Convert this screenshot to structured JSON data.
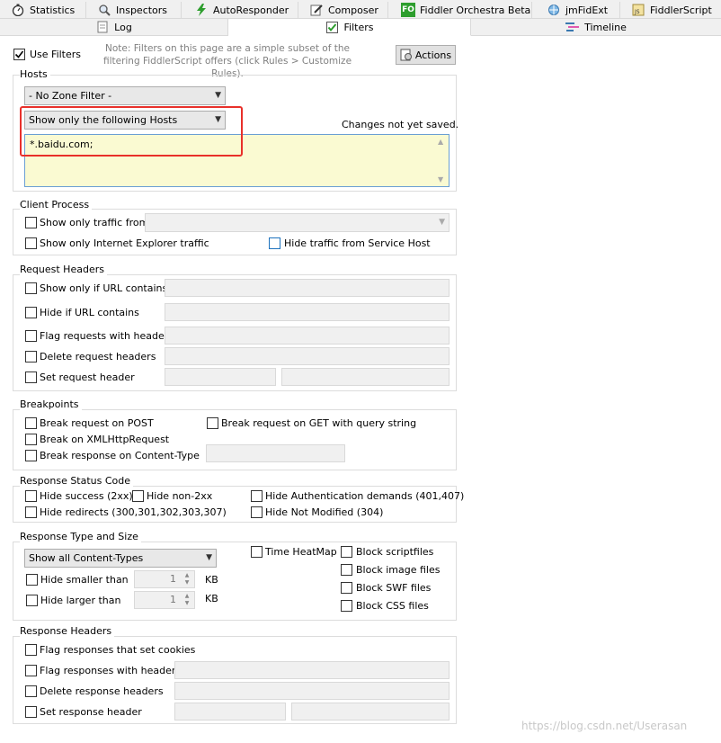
{
  "tabs_row1": [
    {
      "label": "Statistics",
      "icon": "stopwatch-icon"
    },
    {
      "label": "Inspectors",
      "icon": "magnifier-icon"
    },
    {
      "label": "AutoResponder",
      "icon": "lightning-icon"
    },
    {
      "label": "Composer",
      "icon": "pencil-icon"
    },
    {
      "label": "Fiddler Orchestra Beta",
      "icon": "fo-icon"
    },
    {
      "label": "jmFidExt",
      "icon": "globe-icon"
    },
    {
      "label": "FiddlerScript",
      "icon": "script-icon"
    }
  ],
  "tabs_row2": [
    {
      "label": "Log",
      "icon": "log-icon"
    },
    {
      "label": "Filters",
      "icon": "check-icon"
    },
    {
      "label": "Timeline",
      "icon": "timeline-icon"
    }
  ],
  "use_filters_label": "Use Filters",
  "note": "Note: Filters on this page are a simple subset of the filtering FiddlerScript offers (click Rules > Customize Rules).",
  "actions_label": "Actions",
  "hosts": {
    "title": "Hosts",
    "zone_filter": "- No Zone Filter -",
    "host_filter": "Show only the following Hosts",
    "status": "Changes not yet saved.",
    "hosts_text": "*.baidu.com;"
  },
  "client_process": {
    "title": "Client Process",
    "show_only_from": "Show only traffic from",
    "show_only_ie": "Show only Internet Explorer traffic",
    "hide_service_host": "Hide traffic from Service Host"
  },
  "request_headers": {
    "title": "Request Headers",
    "items": [
      "Show only if URL contains",
      "Hide if URL contains",
      "Flag requests with headers",
      "Delete request headers",
      "Set request header"
    ]
  },
  "breakpoints": {
    "title": "Breakpoints",
    "post": "Break request on POST",
    "get_query": "Break request on GET with query string",
    "xhr": "Break on XMLHttpRequest",
    "content_type": "Break response on Content-Type"
  },
  "response_status": {
    "title": "Response Status Code",
    "hide_success": "Hide success (2xx)",
    "hide_non2xx": "Hide non-2xx",
    "hide_auth": "Hide Authentication demands (401,407)",
    "hide_redirects": "Hide redirects (300,301,302,303,307)",
    "hide_not_modified": "Hide Not Modified (304)"
  },
  "response_type": {
    "title": "Response Type and Size",
    "content_types": "Show all Content-Types",
    "time_heatmap": "Time HeatMap",
    "hide_smaller": "Hide smaller than",
    "hide_larger": "Hide larger than",
    "smaller_value": "1",
    "larger_value": "1",
    "unit": "KB",
    "block_script": "Block scriptfiles",
    "block_image": "Block image files",
    "block_swf": "Block SWF files",
    "block_css": "Block CSS files"
  },
  "response_headers": {
    "title": "Response Headers",
    "flag_cookies": "Flag responses that set cookies",
    "flag_headers": "Flag responses with headers",
    "delete_headers": "Delete response headers",
    "set_header": "Set response header"
  },
  "watermark": "https://blog.csdn.net/Userasan",
  "colors": {
    "highlight": "#e8302a",
    "host_box_bg": "#fafad2",
    "accent": "#1e73be"
  }
}
